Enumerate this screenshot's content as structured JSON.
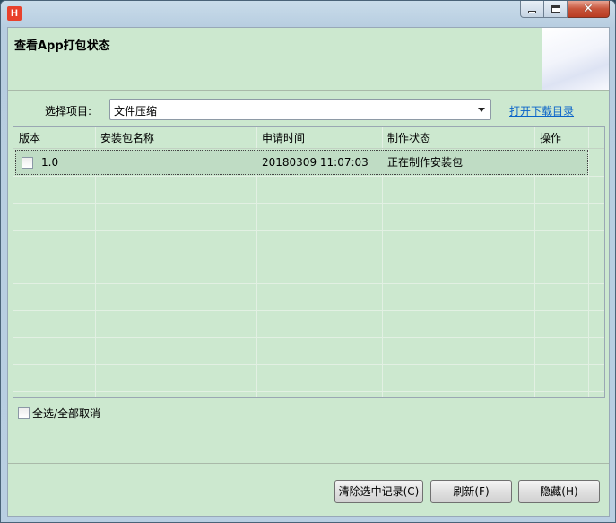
{
  "window": {
    "title_icon_letter": "H",
    "controls": {
      "minimize": "",
      "maximize": "",
      "close": "✕"
    }
  },
  "header": {
    "title": "查看App打包状态"
  },
  "project": {
    "label": "选择项目:",
    "selected": "文件压缩",
    "download_link": "打开下载目录"
  },
  "table": {
    "columns": [
      "版本",
      "安装包名称",
      "申请时间",
      "制作状态",
      "操作"
    ],
    "rows": [
      {
        "checked": false,
        "version": "1.0",
        "package_name": "",
        "time": "20180309 11:07:03",
        "status": "正在制作安装包",
        "action": ""
      }
    ]
  },
  "select_all": {
    "label": "全选/全部取消",
    "checked": false
  },
  "buttons": {
    "clear": "清除选中记录(C)",
    "refresh": "刷新(F)",
    "hide": "隐藏(H)"
  }
}
